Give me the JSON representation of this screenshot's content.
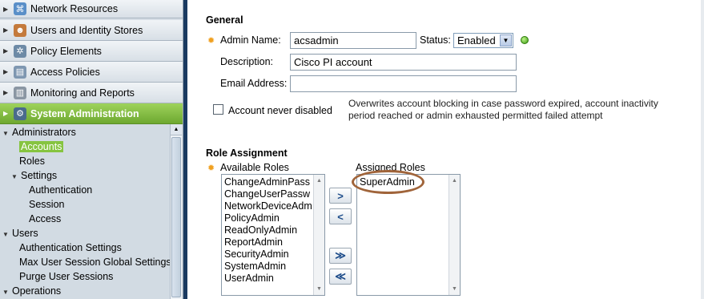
{
  "nav": {
    "drawers": [
      {
        "label": "Network Resources",
        "icon": "network-icon",
        "active": false
      },
      {
        "label": "Users and Identity Stores",
        "icon": "users-icon",
        "active": false
      },
      {
        "label": "Policy Elements",
        "icon": "gear-icon",
        "active": false
      },
      {
        "label": "Access Policies",
        "icon": "policy-icon",
        "active": false
      },
      {
        "label": "Monitoring and Reports",
        "icon": "monitor-icon",
        "active": false
      },
      {
        "label": "System Administration",
        "icon": "system-admin-icon",
        "active": true
      }
    ],
    "tree": [
      {
        "label": "Administrators",
        "expanded": true
      },
      {
        "label": "Accounts",
        "selected": true
      },
      {
        "label": "Roles"
      },
      {
        "label": "Settings",
        "expanded": true
      },
      {
        "label": "Authentication"
      },
      {
        "label": "Session"
      },
      {
        "label": "Access"
      },
      {
        "label": "Users",
        "expanded": true
      },
      {
        "label": "Authentication Settings"
      },
      {
        "label": "Max User Session Global Settings"
      },
      {
        "label": "Purge User Sessions"
      },
      {
        "label": "Operations",
        "expanded": true
      }
    ]
  },
  "general": {
    "title": "General",
    "admin_name_label": "Admin Name:",
    "admin_name_value": "acsadmin",
    "status_label": "Status:",
    "status_value": "Enabled",
    "description_label": "Description:",
    "description_value": "Cisco PI account",
    "email_label": "Email Address:",
    "email_value": "",
    "never_disabled_label": "Account never disabled",
    "never_disabled_note": "Overwrites account blocking in case password expired, account inactivity period reached or admin exhausted permitted failed attempt"
  },
  "roles": {
    "title": "Role Assignment",
    "available_label": "Available Roles",
    "assigned_label": "Assigned Roles",
    "available": [
      "ChangeAdminPass",
      "ChangeUserPassw",
      "NetworkDeviceAdm",
      "PolicyAdmin",
      "ReadOnlyAdmin",
      "ReportAdmin",
      "SecurityAdmin",
      "SystemAdmin",
      "UserAdmin"
    ],
    "assigned": [
      "SuperAdmin"
    ],
    "buttons": {
      "add": ">",
      "remove": "<",
      "add_all": "≫",
      "remove_all": "≪"
    }
  },
  "colors": {
    "active_drawer": "#7cb83a",
    "highlight_circle": "#a0643a",
    "required_star": "#f0a020"
  }
}
